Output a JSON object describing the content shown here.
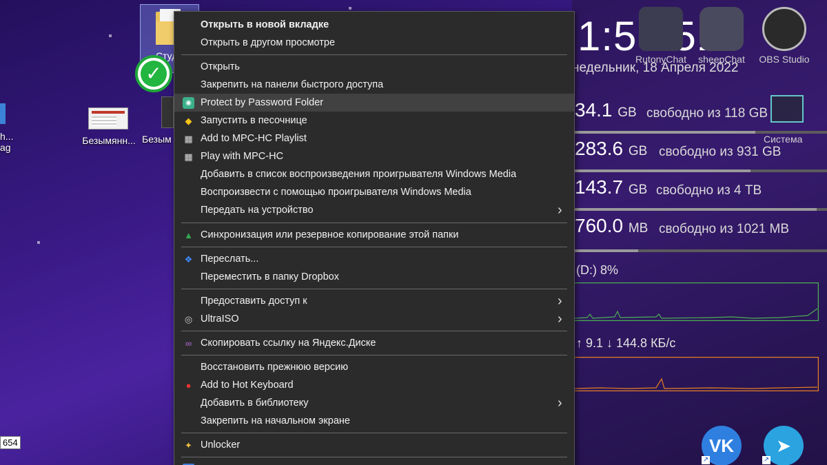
{
  "desktop": {
    "folder_label": "Студ",
    "icon_labels": [
      "Безымянн...",
      "Безым"
    ],
    "left_edge_labels": [
      "h...",
      "ag"
    ],
    "tooltip": "654"
  },
  "widgets": {
    "clock": "1:58:51",
    "date": "недельник, 18 Апреля 2022",
    "top_apps": [
      {
        "name": "RutonyChat",
        "icon": "rutony-chat-icon"
      },
      {
        "name": "sheepChat",
        "icon": "sheep-chat-icon"
      },
      {
        "name": "OBS Studio",
        "icon": "obs-icon"
      }
    ],
    "system_label": "Система",
    "drives": [
      {
        "value": "34.1",
        "unit": "GB",
        "free": "свободно из 118 GB",
        "fill": 0.71
      },
      {
        "value": "283.6",
        "unit": "GB",
        "free": "свободно из 931 GB",
        "fill": 0.7
      },
      {
        "value": "143.7",
        "unit": "GB",
        "free": "свободно из 4 TB",
        "fill": 0.96
      },
      {
        "value": "760.0",
        "unit": "MB",
        "free": "свободно из 1021 MB",
        "fill": 0.26
      }
    ],
    "disk_activity": "(D:)  8%",
    "network": "↑ 9.1 ↓ 144.8 КБ/с",
    "bottom_apps": [
      {
        "name": "VK",
        "label": "VK",
        "color": "#2f7fe0"
      },
      {
        "name": "Telegram",
        "label": "➤",
        "color": "#2aa3e0"
      }
    ],
    "colors": {
      "disk_graph": "#4caf50",
      "net_graph": "#e67e22"
    }
  },
  "context_menu": {
    "items": [
      {
        "label": "Открыть в новой вкладке",
        "bold": true
      },
      {
        "label": "Открыть в другом просмотре"
      },
      {
        "sep": true
      },
      {
        "label": "Открыть"
      },
      {
        "label": "Закрепить на панели быстрого доступа"
      },
      {
        "label": "Protect by Password Folder",
        "icon": "lock-camera-icon",
        "hover": true
      },
      {
        "label": "Запустить в песочнице",
        "icon": "sandbox-icon"
      },
      {
        "label": "Add to MPC-HC Playlist",
        "icon": "film-icon"
      },
      {
        "label": "Play with MPC-HC",
        "icon": "film-icon"
      },
      {
        "label": "Добавить в список воспроизведения проигрывателя Windows Media"
      },
      {
        "label": "Воспроизвести с помощью проигрывателя Windows Media"
      },
      {
        "label": "Передать на устройство",
        "submenu": true
      },
      {
        "sep": true
      },
      {
        "label": "Синхронизация или резервное копирование этой папки",
        "icon": "google-drive-icon"
      },
      {
        "sep": true
      },
      {
        "label": "Переслать...",
        "icon": "dropbox-icon"
      },
      {
        "label": "Переместить в папку Dropbox"
      },
      {
        "sep": true
      },
      {
        "label": "Предоставить доступ к",
        "submenu": true
      },
      {
        "label": "UltraISO",
        "icon": "ultraiso-icon",
        "submenu": true
      },
      {
        "sep": true
      },
      {
        "label": "Скопировать ссылку на Яндекс.Диске",
        "icon": "link-icon"
      },
      {
        "sep": true
      },
      {
        "label": "Восстановить прежнюю версию"
      },
      {
        "label": "Add to Hot Keyboard",
        "icon": "hot-keyboard-icon"
      },
      {
        "label": "Добавить в библиотеку",
        "submenu": true
      },
      {
        "label": "Закрепить на начальном экране"
      },
      {
        "sep": true
      },
      {
        "label": "Unlocker",
        "icon": "unlocker-icon"
      },
      {
        "sep": true
      },
      {
        "label": "",
        "icon": "more-icon",
        "submenu": true
      }
    ]
  }
}
